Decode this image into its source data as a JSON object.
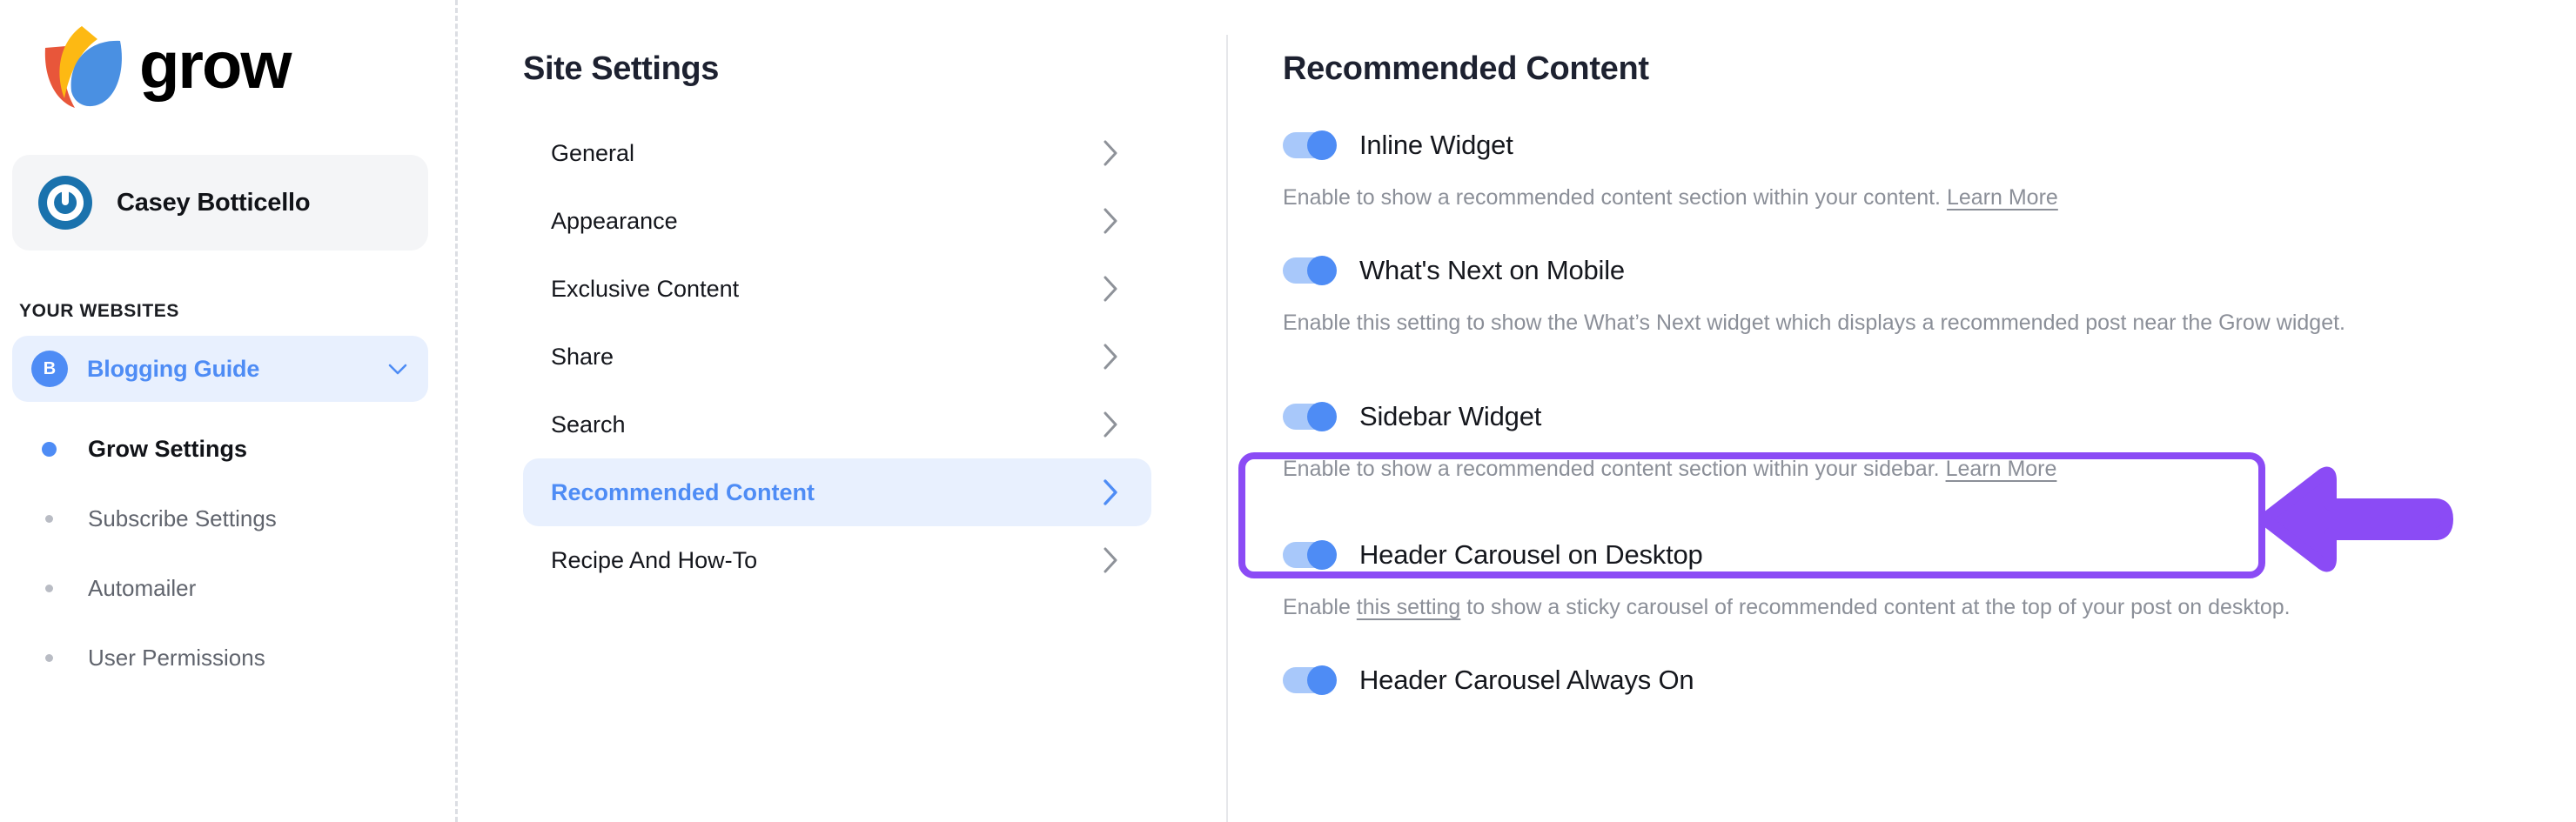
{
  "brand": {
    "name": "grow",
    "logo_icon": "grow-leaf-logo",
    "colors": {
      "red": "#e8563a",
      "yellow": "#fdb913",
      "blue": "#4a90e2"
    }
  },
  "account": {
    "name": "Casey Botticello",
    "avatar_icon": "power-button-avatar",
    "avatar_color": "#1a72ad"
  },
  "sidebar": {
    "section_label": "YOUR WEBSITES",
    "site": {
      "badge": "B",
      "name": "Blogging Guide",
      "expand_icon": "chevron-down-icon",
      "accent": "#4e8cf5"
    },
    "items": [
      {
        "label": "Grow Settings",
        "active": true
      },
      {
        "label": "Subscribe Settings",
        "active": false
      },
      {
        "label": "Automailer",
        "active": false
      },
      {
        "label": "User Permissions",
        "active": false
      }
    ]
  },
  "site_settings": {
    "title": "Site Settings",
    "items": [
      {
        "label": "General",
        "selected": false
      },
      {
        "label": "Appearance",
        "selected": false
      },
      {
        "label": "Exclusive Content",
        "selected": false
      },
      {
        "label": "Share",
        "selected": false
      },
      {
        "label": "Search",
        "selected": false
      },
      {
        "label": "Recommended Content",
        "selected": true
      },
      {
        "label": "Recipe And How-To",
        "selected": false
      }
    ],
    "chevron_icon": "chevron-right-icon"
  },
  "panel": {
    "title": "Recommended Content",
    "settings": [
      {
        "name": "Inline Widget",
        "enabled": true,
        "desc_pre": "Enable to show a recommended content section within your content. ",
        "desc_link": "Learn More",
        "desc_post": ""
      },
      {
        "name": "What's Next on Mobile",
        "enabled": true,
        "desc_pre": "Enable this setting to show the What’s Next widget which displays a recommended post near the Grow widget.",
        "desc_link": "",
        "desc_post": ""
      },
      {
        "name": "Sidebar Widget",
        "enabled": true,
        "highlighted": true,
        "desc_pre": "Enable to show a recommended content section within your sidebar. ",
        "desc_link": "Learn More",
        "desc_post": ""
      },
      {
        "name": "Header Carousel on Desktop",
        "enabled": true,
        "desc_pre": "Enable ",
        "desc_link": "this setting",
        "desc_post": " to show a sticky carousel of recommended content at the top of your post on desktop."
      },
      {
        "name": "Header Carousel Always On",
        "enabled": true,
        "desc_pre": "",
        "desc_link": "",
        "desc_post": ""
      }
    ],
    "toggle_on_color": "#4e8cf5",
    "toggle_track_color": "#a8c8fa"
  },
  "annotations": {
    "highlight_color": "#8b4bf5",
    "arrow_icon": "left-arrow-annotation",
    "arrow_direction": "left",
    "highlight_target": "Sidebar Widget"
  }
}
